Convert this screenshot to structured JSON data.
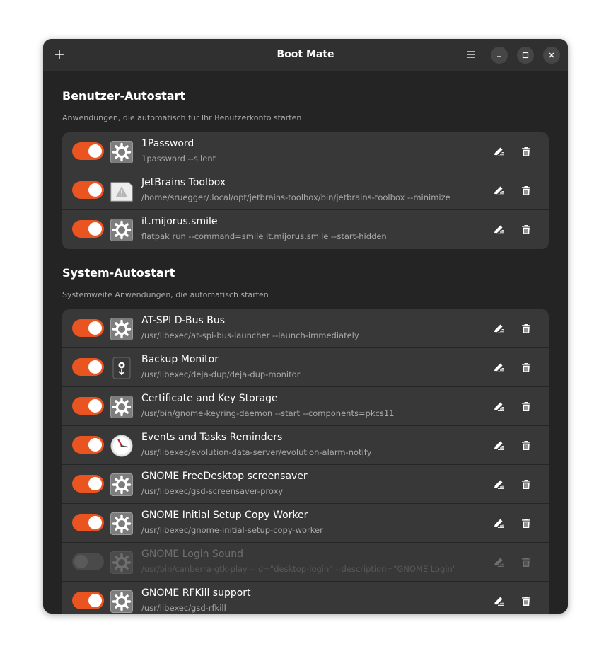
{
  "window": {
    "title": "Boot Mate"
  },
  "header": {
    "add_icon": "plus-icon",
    "menu_icon": "hamburger-menu-icon",
    "minimize_icon": "minimize-icon",
    "maximize_icon": "maximize-icon",
    "close_icon": "close-icon"
  },
  "colors": {
    "accent": "#e95420",
    "window_bg": "#242424",
    "list_bg": "#383838",
    "subtitle": "#a9a9a9"
  },
  "user_section": {
    "title": "Benutzer-Autostart",
    "subtitle": "Anwendungen, die automatisch für Ihr Benutzerkonto starten",
    "items": [
      {
        "name": "1Password",
        "command": "1password --silent",
        "enabled": true,
        "icon": "gear-icon"
      },
      {
        "name": "JetBrains Toolbox",
        "command": "/home/sruegger/.local/opt/jetbrains-toolbox/bin/jetbrains-toolbox --minimize",
        "enabled": true,
        "icon": "missing-image-warning-icon"
      },
      {
        "name": "it.mijorus.smile",
        "command": "flatpak run --command=smile it.mijorus.smile --start-hidden",
        "enabled": true,
        "icon": "gear-icon"
      }
    ]
  },
  "system_section": {
    "title": "System-Autostart",
    "subtitle": "Systemweite Anwendungen, die automatisch starten",
    "items": [
      {
        "name": "AT-SPI D-Bus Bus",
        "command": "/usr/libexec/at-spi-bus-launcher --launch-immediately",
        "enabled": true,
        "icon": "gear-icon"
      },
      {
        "name": "Backup Monitor",
        "command": "/usr/libexec/deja-dup/deja-dup-monitor",
        "enabled": true,
        "icon": "backup-safe-icon"
      },
      {
        "name": "Certificate and Key Storage",
        "command": "/usr/bin/gnome-keyring-daemon --start --components=pkcs11",
        "enabled": true,
        "icon": "gear-icon"
      },
      {
        "name": "Events and Tasks Reminders",
        "command": "/usr/libexec/evolution-data-server/evolution-alarm-notify",
        "enabled": true,
        "icon": "clock-icon"
      },
      {
        "name": "GNOME FreeDesktop screensaver",
        "command": "/usr/libexec/gsd-screensaver-proxy",
        "enabled": true,
        "icon": "gear-icon"
      },
      {
        "name": "GNOME Initial Setup Copy Worker",
        "command": "/usr/libexec/gnome-initial-setup-copy-worker",
        "enabled": true,
        "icon": "gear-icon"
      },
      {
        "name": "GNOME Login Sound",
        "command": "/usr/bin/canberra-gtk-play --id=\"desktop-login\" --description=\"GNOME Login\"",
        "enabled": false,
        "icon": "gear-icon"
      },
      {
        "name": "GNOME RFKill support",
        "command": "/usr/libexec/gsd-rfkill",
        "enabled": true,
        "icon": "gear-icon"
      }
    ]
  },
  "row_actions": {
    "edit_icon": "edit-pencil-icon",
    "delete_icon": "trash-icon"
  }
}
